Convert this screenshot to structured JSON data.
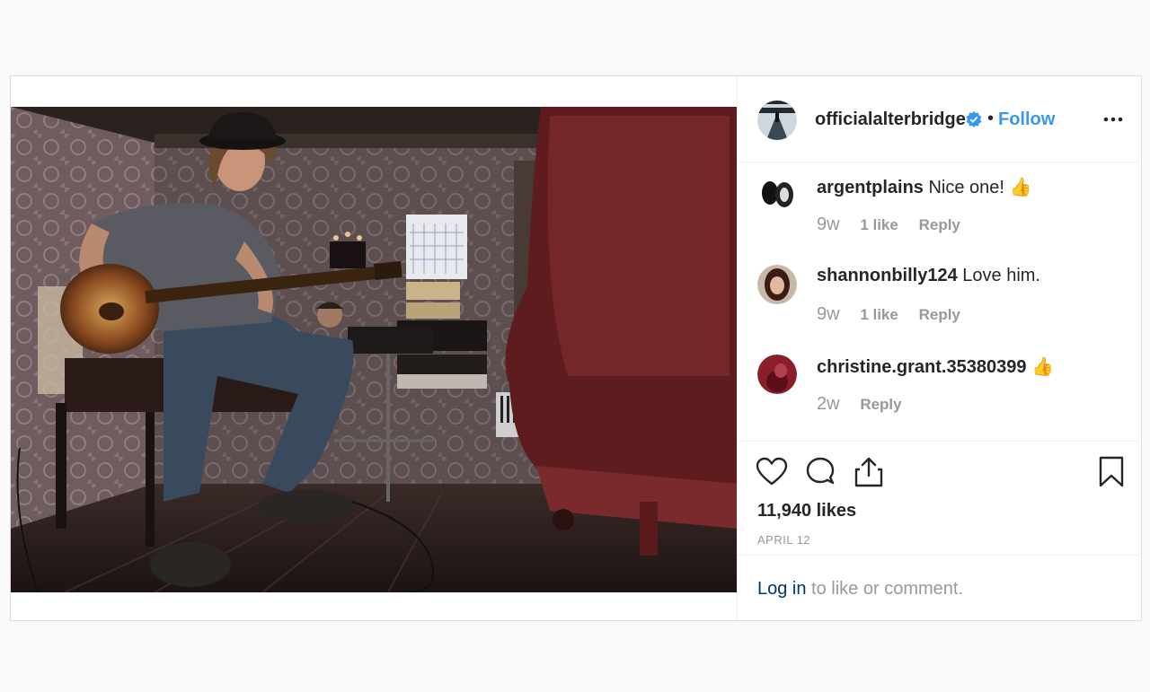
{
  "post": {
    "username": "officialalterbridge",
    "follow_label": "Follow",
    "separator": "•"
  },
  "comments": [
    {
      "user": "argentplains",
      "text": "Nice one! 👍",
      "time": "9w",
      "likes": "1 like",
      "reply": "Reply"
    },
    {
      "user": "shannonbilly124",
      "text": "Love him.",
      "time": "9w",
      "likes": "1 like",
      "reply": "Reply"
    },
    {
      "user": "christine.grant.35380399",
      "text": "👍",
      "time": "2w",
      "reply": "Reply"
    }
  ],
  "actions": {
    "likes": "11,940 likes",
    "date": "APRIL 12"
  },
  "login": {
    "link": "Log in",
    "rest": " to like or comment."
  },
  "icons": [
    "verified-badge-icon",
    "more-options-icon",
    "heart-icon",
    "comment-icon",
    "share-icon",
    "bookmark-icon"
  ],
  "colors": {
    "link_blue": "#3897f0",
    "login_link": "#003569",
    "muted": "#999999",
    "text": "#262626"
  }
}
